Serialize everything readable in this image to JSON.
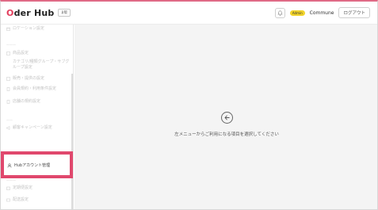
{
  "header": {
    "logo_o": "O",
    "logo_rest": "der Hub",
    "logo_badge": "β版",
    "admin_badge": "Admin",
    "org_name": "Commune",
    "logout_label": "ログアウト"
  },
  "sidebar": {
    "items": [
      {
        "label": "ロケーション設定"
      },
      {
        "label": "商品設定"
      },
      {
        "label": "カテゴリ/種類グループ・サブグループ設定"
      },
      {
        "label": "販売・提供の設定"
      },
      {
        "label": "会員規約・利用条件設定"
      },
      {
        "label": "店舗の規約設定"
      },
      {
        "label": "顧客キャンペーン設定"
      }
    ],
    "highlighted_item": "Hubアカウント管理",
    "bottom_items": [
      {
        "label": "定期便設定"
      },
      {
        "label": "配送設定"
      }
    ]
  },
  "main": {
    "empty_message": "左メニューからご利用になる項目を選択してください"
  }
}
